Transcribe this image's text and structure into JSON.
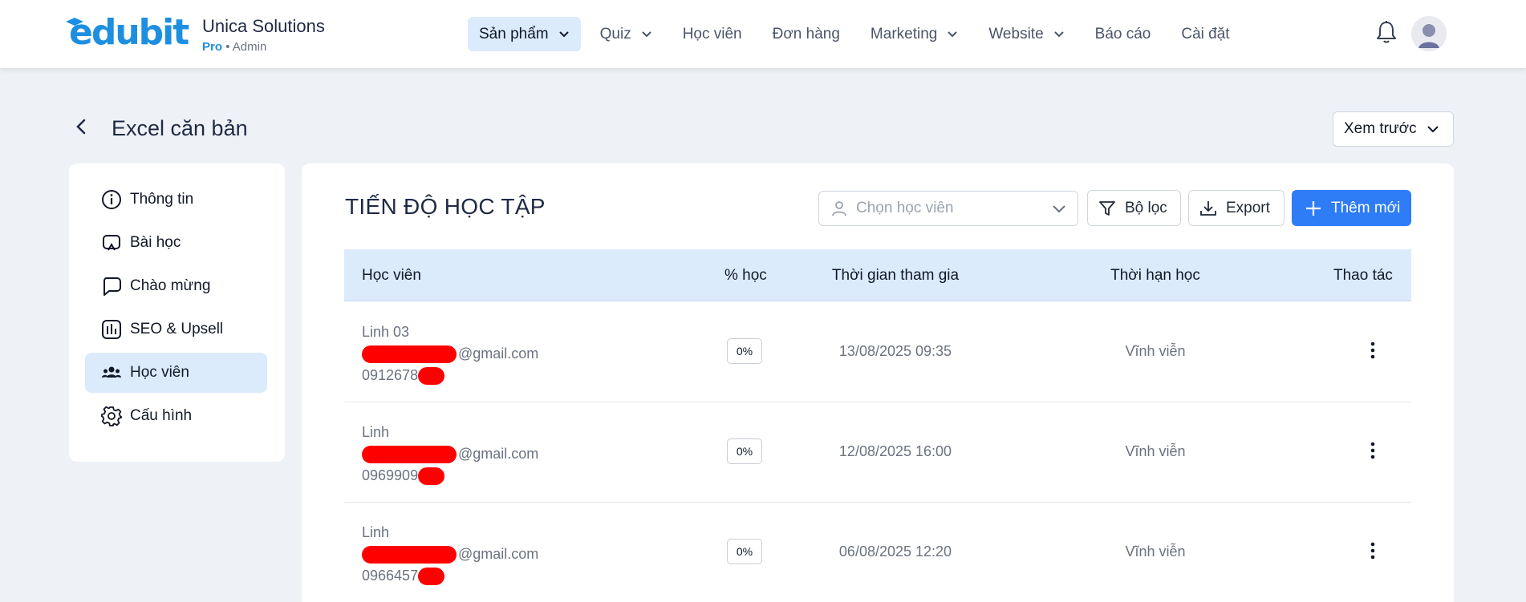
{
  "brand": {
    "logo_text": "edubit",
    "company": "Unica Solutions",
    "plan": "Pro",
    "separator": "•",
    "role": "Admin"
  },
  "nav": {
    "items": [
      {
        "label": "Sản phẩm",
        "active": true,
        "dropdown": true
      },
      {
        "label": "Quiz",
        "dropdown": true
      },
      {
        "label": "Học viên"
      },
      {
        "label": "Đơn hàng"
      },
      {
        "label": "Marketing",
        "dropdown": true
      },
      {
        "label": "Website",
        "dropdown": true
      },
      {
        "label": "Báo cáo"
      },
      {
        "label": "Cài đặt"
      }
    ],
    "bell_icon": "bell-icon",
    "avatar_icon": "user-avatar"
  },
  "page": {
    "title": "Excel căn bản",
    "preview_label": "Xem trước"
  },
  "sidebar": {
    "items": [
      {
        "label": "Thông tin",
        "icon": "info-icon"
      },
      {
        "label": "Bài học",
        "icon": "lesson-icon"
      },
      {
        "label": "Chào mừng",
        "icon": "chat-bubble-icon"
      },
      {
        "label": "SEO & Upsell",
        "icon": "bar-chart-icon"
      },
      {
        "label": "Học viên",
        "icon": "users-icon",
        "active": true
      },
      {
        "label": "Cấu hình",
        "icon": "gear-icon"
      }
    ]
  },
  "main": {
    "section_title": "TIẾN ĐỘ HỌC TẬP",
    "student_select_placeholder": "Chọn học viên",
    "filter_label": "Bộ lọc",
    "export_label": "Export",
    "add_label": "Thêm mới",
    "columns": [
      "Học viên",
      "% học",
      "Thời gian tham gia",
      "Thời hạn học",
      "Thao tác"
    ],
    "rows": [
      {
        "name": "Linh 03",
        "email_suffix": "@gmail.com",
        "phone_prefix": "0912678",
        "progress": "0%",
        "joined": "13/08/2025 09:35",
        "deadline": "Vĩnh viễn"
      },
      {
        "name": "Linh",
        "email_suffix": "@gmail.com",
        "phone_prefix": "0969909",
        "progress": "0%",
        "joined": "12/08/2025 16:00",
        "deadline": "Vĩnh viễn"
      },
      {
        "name": "Linh",
        "email_suffix": "@gmail.com",
        "phone_prefix": "0966457",
        "progress": "0%",
        "joined": "06/08/2025 12:20",
        "deadline": "Vĩnh viễn"
      }
    ]
  },
  "colors": {
    "accent": "#2e7cf6",
    "brand_blue": "#1e8fe0",
    "active_bg": "#dcebfb",
    "page_bg": "#eef2f6",
    "redaction": "#ff0000"
  }
}
